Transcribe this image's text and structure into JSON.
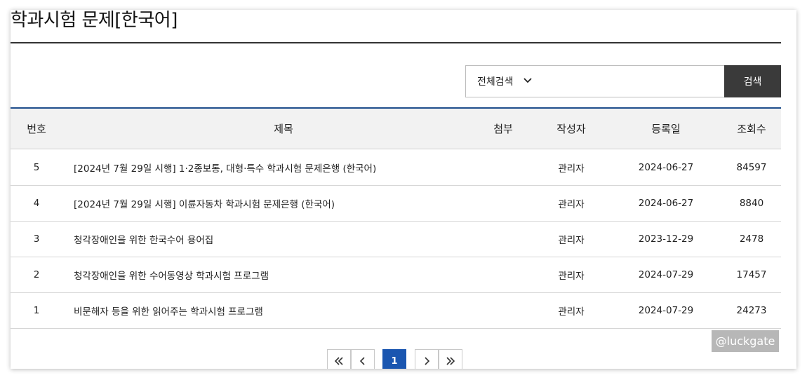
{
  "page": {
    "title": "학과시험 문제[한국어]"
  },
  "search": {
    "scope_selected": "전체검색",
    "input_value": "",
    "button_label": "검색"
  },
  "table": {
    "headers": {
      "num": "번호",
      "title": "제목",
      "attachment": "첨부",
      "author": "작성자",
      "date": "등록일",
      "views": "조회수"
    },
    "rows": [
      {
        "num": "5",
        "title": "[2024년 7월 29일 시행] 1·2종보통, 대형·특수 학과시험 문제은행 (한국어)",
        "attachment": "",
        "author": "관리자",
        "date": "2024-06-27",
        "views": "84597"
      },
      {
        "num": "4",
        "title": "[2024년 7월 29일 시행] 이륜자동차 학과시험 문제은행 (한국어)",
        "attachment": "",
        "author": "관리자",
        "date": "2024-06-27",
        "views": "8840"
      },
      {
        "num": "3",
        "title": "청각장애인을 위한 한국수어 용어집",
        "attachment": "",
        "author": "관리자",
        "date": "2023-12-29",
        "views": "2478"
      },
      {
        "num": "2",
        "title": "청각장애인을 위한 수어동영상 학과시험 프로그램",
        "attachment": "",
        "author": "관리자",
        "date": "2024-07-29",
        "views": "17457"
      },
      {
        "num": "1",
        "title": "비문해자 등을 위한 읽어주는 학과시험 프로그램",
        "attachment": "",
        "author": "관리자",
        "date": "2024-07-29",
        "views": "24273"
      }
    ]
  },
  "pagination": {
    "current": "1",
    "icons": [
      "first-page-icon",
      "prev-page-icon",
      "next-page-icon",
      "last-page-icon"
    ]
  },
  "watermark": {
    "text": "@luckgate"
  },
  "colors": {
    "accent": "#1a56b0",
    "search_button": "#3a3a3a",
    "header_bg": "#f2f2f2"
  }
}
